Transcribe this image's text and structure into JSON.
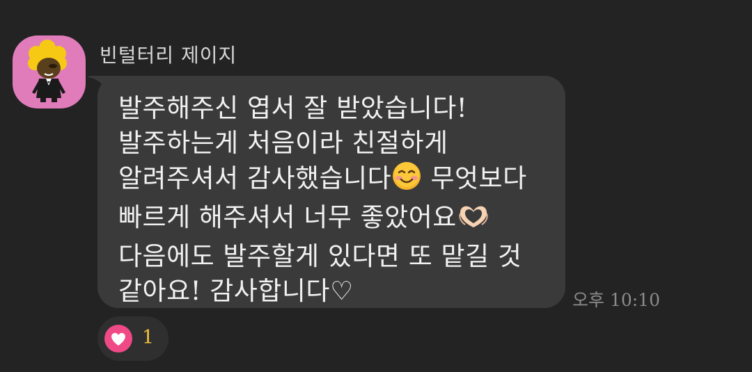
{
  "sender": {
    "name": "빈털터리 제이지"
  },
  "message": {
    "lines": [
      [
        "발주해주신 엽서 잘 받았습니다!"
      ],
      [
        "발주하는게 처음이라 친절하게"
      ],
      [
        "알려주셔서 감사했습니다",
        "☺️",
        " 무엇보다"
      ],
      [
        "빠르게 해주셔서 너무 좋았어요",
        "🫶"
      ],
      [
        "다음에도 발주할게 있다면 또 맡길 것"
      ],
      [
        "같아요! 감사합니다♡"
      ]
    ],
    "timestamp": "오후 10:10"
  },
  "reaction": {
    "icon": "heart-icon",
    "count": "1",
    "color": "#ef4a86"
  },
  "colors": {
    "background": "#232324",
    "bubble": "#3a3a3b",
    "avatar_bg": "#e17cbb",
    "reaction_count": "#f0c33c"
  }
}
